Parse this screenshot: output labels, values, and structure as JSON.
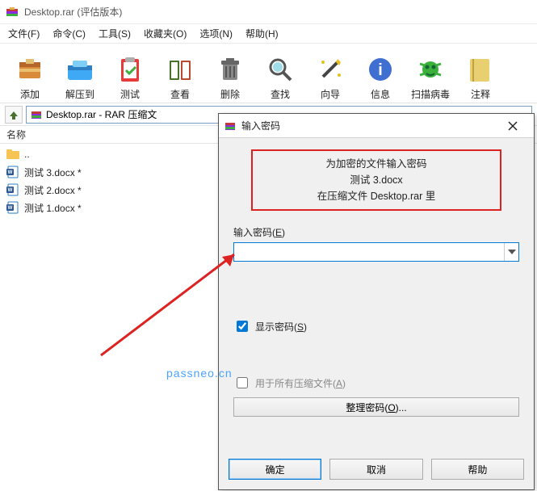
{
  "titlebar": {
    "title": "Desktop.rar (评估版本)"
  },
  "menubar": {
    "items": [
      {
        "label": "文件(F)"
      },
      {
        "label": "命令(C)"
      },
      {
        "label": "工具(S)"
      },
      {
        "label": "收藏夹(O)"
      },
      {
        "label": "选项(N)"
      },
      {
        "label": "帮助(H)"
      }
    ]
  },
  "toolbar": {
    "items": [
      {
        "label": "添加"
      },
      {
        "label": "解压到"
      },
      {
        "label": "测试"
      },
      {
        "label": "查看"
      },
      {
        "label": "删除"
      },
      {
        "label": "查找"
      },
      {
        "label": "向导"
      },
      {
        "label": "信息"
      },
      {
        "label": "扫描病毒"
      },
      {
        "label": "注释"
      }
    ]
  },
  "nav": {
    "address": "Desktop.rar - RAR 压缩文"
  },
  "list_header": {
    "name": "名称"
  },
  "files": [
    {
      "name": "..",
      "type": "folder"
    },
    {
      "name": "测试 3.docx *",
      "type": "doc"
    },
    {
      "name": "测试 2.docx *",
      "type": "doc"
    },
    {
      "name": "测试 1.docx *",
      "type": "doc"
    }
  ],
  "dialog": {
    "title": "输入密码",
    "prompt_line1": "为加密的文件输入密码",
    "prompt_line2": "测试 3.docx",
    "prompt_line3": "在压缩文件 Desktop.rar 里",
    "field_label_prefix": "输入密码(",
    "field_label_key": "E",
    "field_label_suffix": ")",
    "password_value": "",
    "show_password_prefix": "显示密码(",
    "show_password_key": "S",
    "show_password_suffix": ")",
    "show_password_checked": true,
    "use_all_prefix": "用于所有压缩文件(",
    "use_all_key": "A",
    "use_all_suffix": ")",
    "use_all_checked": false,
    "organize_prefix": "整理密码(",
    "organize_key": "O",
    "organize_suffix": ")...",
    "ok": "确定",
    "cancel": "取消",
    "help": "帮助"
  },
  "watermark": "passneo.cn"
}
